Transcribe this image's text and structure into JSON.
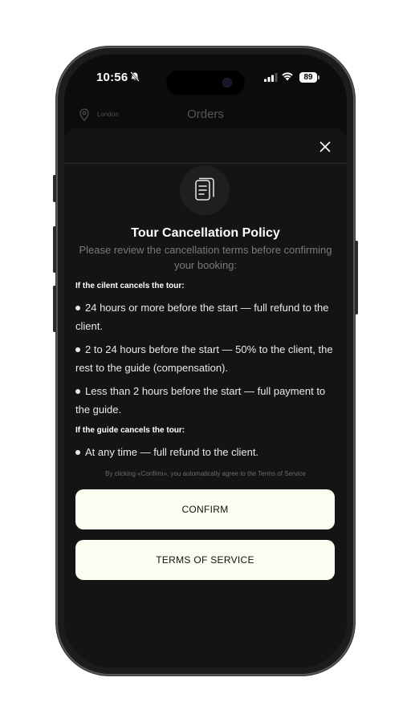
{
  "status_bar": {
    "time": "10:56",
    "battery": "89"
  },
  "background": {
    "location": "London",
    "title": "Orders"
  },
  "sheet": {
    "title": "Tour Cancellation Policy",
    "subtitle": "Please review the cancellation terms before confirming your booking:",
    "client_section": {
      "heading": "If the cilent cancels the tour:",
      "rules": [
        "24 hours or more before the start — full refund to the client.",
        "2 to 24 hours before the start — 50% to the client, the rest to the guide (compensation).",
        "Less than 2 hours before the start — full payment to the guide."
      ]
    },
    "guide_section": {
      "heading": "If the guide cancels the tour:",
      "rules": [
        "At any time — full refund to the client."
      ]
    },
    "agreement_note": "By clicking «Confirm», you automatically agree to the Terms of Service",
    "confirm_label": "CONFIRM",
    "terms_label": "TERMS OF SERVICE"
  },
  "icons": {
    "close": "close-icon",
    "document": "document-icon",
    "location": "location-pin-icon",
    "mute": "bell-slash-icon",
    "signal": "cellular-signal-icon",
    "wifi": "wifi-icon"
  },
  "colors": {
    "button_bg": "#fdfcf0",
    "sheet_bg": "#141415",
    "screen_bg": "#0c0c0d"
  }
}
